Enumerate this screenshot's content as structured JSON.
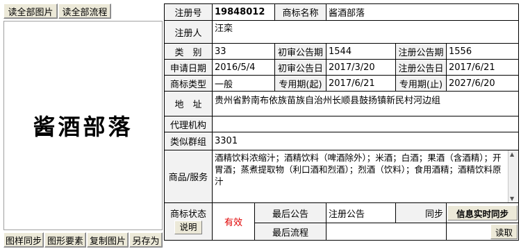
{
  "top_buttons": {
    "read_all_images": "读全部图片",
    "read_all_flows": "读全部流程"
  },
  "mark_image": {
    "text": "酱酒部落"
  },
  "bottom_buttons": {
    "image_sync": "图样同步",
    "graphic_elements": "图形要素",
    "copy_image": "复制图片",
    "save_as": "另存为"
  },
  "info": {
    "reg_no_label": "注册号",
    "reg_no_value": "19848012",
    "mark_name_label": "商标名称",
    "mark_name_value": "酱酒部落",
    "registrant_label": "注册人",
    "registrant_value": "汪栾",
    "class_label": "类　别",
    "class_value": "33",
    "prelim_issue_label": "初审公告期",
    "prelim_issue_value": "1544",
    "reg_issue_label": "注册公告期",
    "reg_issue_value": "1556",
    "app_date_label": "申请日期",
    "app_date_value": "2016/5/4",
    "prelim_date_label": "初审公告日",
    "prelim_date_value": "2017/3/20",
    "reg_date_label": "注册公告日",
    "reg_date_value": "2017/6/21",
    "mark_type_label": "商标类型",
    "mark_type_value": "一般",
    "excl_start_label": "专用期(起)",
    "excl_start_value": "2017/6/21",
    "excl_end_label": "专用期(止)",
    "excl_end_value": "2027/6/20",
    "address_label": "地　址",
    "address_value": "贵州省黔南布依族苗族自治州长顺县鼓扬镇新民村河边组",
    "agent_label": "代理机构",
    "agent_value": "",
    "similar_group_label": "类似群组",
    "similar_group_value": "3301",
    "goods_label": "商品/服务",
    "goods_value": "酒精饮料浓缩汁；酒精饮料（啤酒除外）；米酒；白酒；果酒（含酒精）；开胃酒；蒸煮提取物（利口酒和烈酒）；烈酒（饮料）；食用酒精；酒精饮料原汁",
    "status_label": "商标状态",
    "status_explain_button": "说明",
    "status_value": "有效",
    "last_notice_label": "最后公告",
    "last_notice_value": "注册公告",
    "sync_label": "同步",
    "sync_button": "信息实时同步",
    "last_flow_label": "最后流程",
    "last_flow_value": "",
    "read_button": "读取"
  }
}
